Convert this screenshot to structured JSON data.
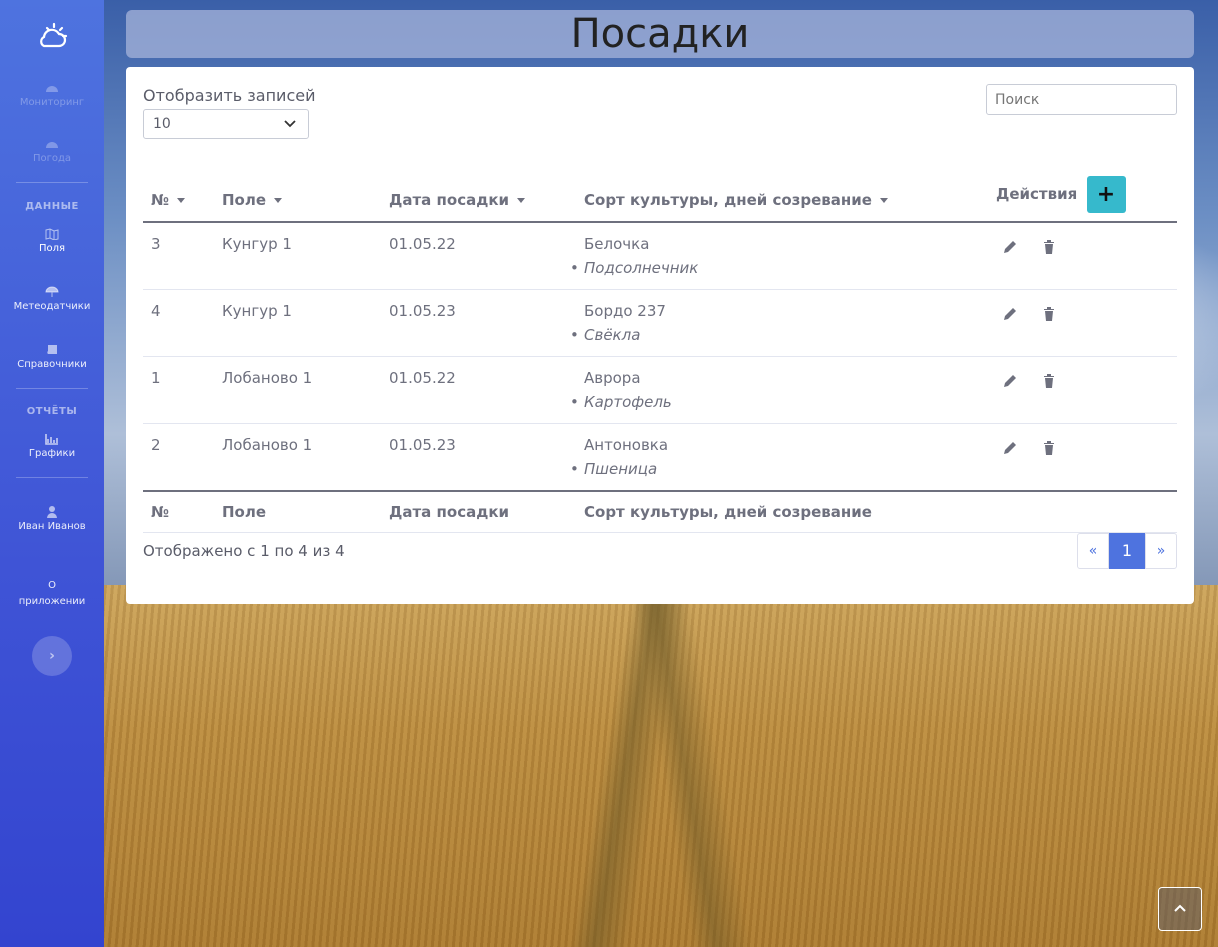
{
  "sidebar": {
    "items": [
      {
        "label": "Мониторинг",
        "icon": "dashboard-icon"
      },
      {
        "label": "Погода",
        "icon": "weather-icon"
      },
      {
        "label": "Поля",
        "icon": "map-icon"
      },
      {
        "label": "Метеодатчики",
        "icon": "umbrella-icon"
      },
      {
        "label": "Справочники",
        "icon": "book-icon"
      },
      {
        "label": "Графики",
        "icon": "chart-icon"
      },
      {
        "label": "Иван Иванов",
        "icon": "user-icon"
      },
      {
        "label": "О приложении",
        "icon": ""
      }
    ],
    "sections": {
      "data": "ДАННЫЕ",
      "reports": "ОТЧЁТЫ"
    },
    "toggle": "›"
  },
  "page": {
    "title": "Посадки"
  },
  "controls": {
    "length_label": "Отобразить записей",
    "length_value": "10",
    "search_placeholder": "Поиск"
  },
  "table": {
    "columns": [
      "№",
      "Поле",
      "Дата посадки",
      "Сорт культуры, дней созревание",
      "Действия"
    ],
    "rows": [
      {
        "id": "3",
        "field": "Кунгур 1",
        "date": "01.05.22",
        "variety": "Белочка",
        "crop": "Подсолнечник"
      },
      {
        "id": "4",
        "field": "Кунгур 1",
        "date": "01.05.23",
        "variety": "Бордо 237",
        "crop": "Свёкла"
      },
      {
        "id": "1",
        "field": "Лобаново 1",
        "date": "01.05.22",
        "variety": "Аврора",
        "crop": "Картофель"
      },
      {
        "id": "2",
        "field": "Лобаново 1",
        "date": "01.05.23",
        "variety": "Антоновка",
        "crop": "Пшеница"
      }
    ],
    "add_label": "+"
  },
  "footer": {
    "info": "Отображено с 1 по 4 из 4",
    "pager": {
      "prev": "«",
      "current": "1",
      "next": "»"
    }
  },
  "colors": {
    "sidebar": "#4e73df",
    "accent": "#36b9cc",
    "primary": "#4e73df"
  }
}
